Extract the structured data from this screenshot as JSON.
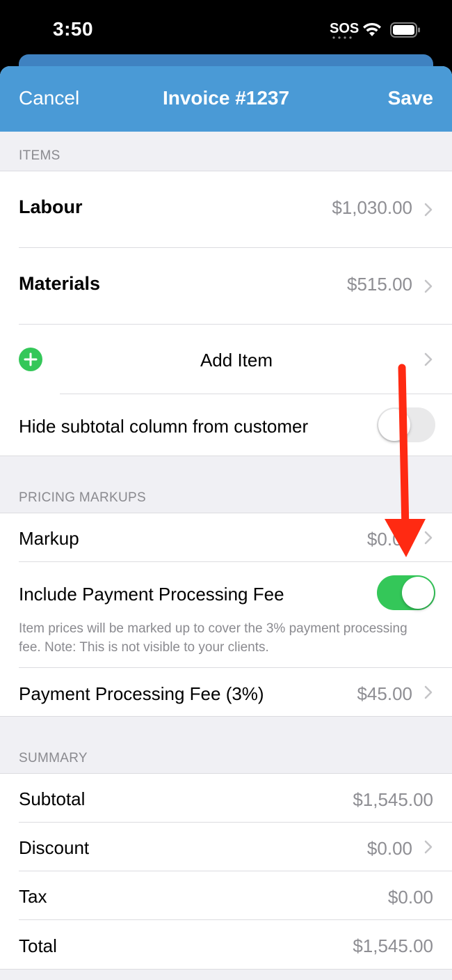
{
  "status_bar": {
    "time": "3:50",
    "sos": "SOS",
    "icons": [
      "wifi-icon",
      "battery-icon"
    ]
  },
  "nav": {
    "cancel_label": "Cancel",
    "title": "Invoice #1237",
    "save_label": "Save",
    "color": "#4a9ad6"
  },
  "items_section": {
    "header": "ITEMS",
    "rows": [
      {
        "label": "Labour",
        "value": "$1,030.00"
      },
      {
        "label": "Materials",
        "value": "$515.00"
      }
    ],
    "add_item_label": "Add Item",
    "hide_subtotal_label": "Hide subtotal column from customer",
    "hide_subtotal_on": false
  },
  "markups_section": {
    "header": "PRICING MARKUPS",
    "markup_label": "Markup",
    "markup_value": "$0.00",
    "fee_toggle_label": "Include Payment Processing Fee",
    "fee_toggle_on": true,
    "footnote": "Item prices will be marked up to cover the 3% payment processing fee. Note: This is not visible to your clients.",
    "fee_label": "Payment Processing Fee (3%)",
    "fee_value": "$45.00"
  },
  "summary_section": {
    "header": "SUMMARY",
    "rows": [
      {
        "label": "Subtotal",
        "value": "$1,545.00"
      },
      {
        "label": "Discount",
        "value": "$0.00"
      },
      {
        "label": "Tax",
        "value": "$0.00"
      },
      {
        "label": "Total",
        "value": "$1,545.00"
      }
    ]
  },
  "colors": {
    "accent_green": "#34c759",
    "annotation_arrow": "#ff2a12"
  }
}
